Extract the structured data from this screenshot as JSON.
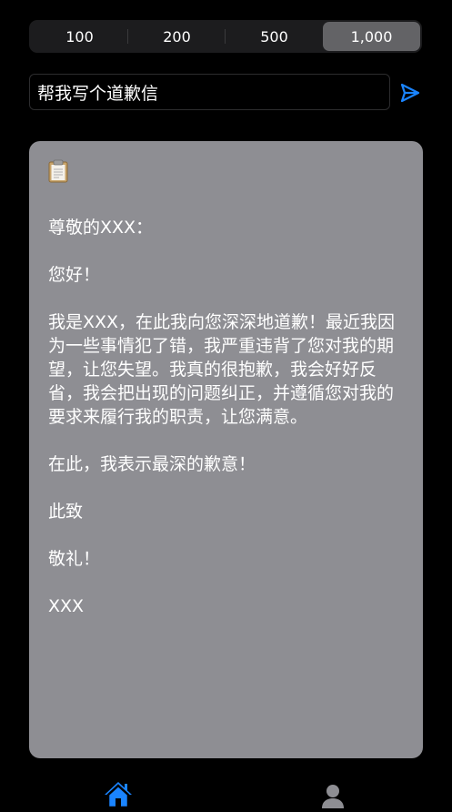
{
  "length_selector": {
    "options": [
      "100",
      "200",
      "500",
      "1,000"
    ],
    "selected": "1,000"
  },
  "prompt": {
    "value": "帮我写个道歉信"
  },
  "result": {
    "icon": "clipboard-icon",
    "paragraphs": [
      "尊敬的XXX：",
      "您好！",
      "我是XXX，在此我向您深深地道歉！最近我因为一些事情犯了错，我严重违背了您对我的期望，让您失望。我真的很抱歉，我会好好反省，我会把出现的问题纠正，并遵循您对我的要求来履行我的职责，让您满意。",
      "在此，我表示最深的歉意！",
      "此致",
      "敬礼！",
      "XXX"
    ]
  },
  "tabbar": {
    "items": [
      {
        "icon": "home-icon",
        "active": true
      },
      {
        "icon": "person-icon",
        "active": false
      }
    ]
  },
  "colors": {
    "accent": "#1a84ff",
    "card": "#8e8e93",
    "segment_selected": "#636366",
    "segment_bg": "#1c1c1e"
  }
}
